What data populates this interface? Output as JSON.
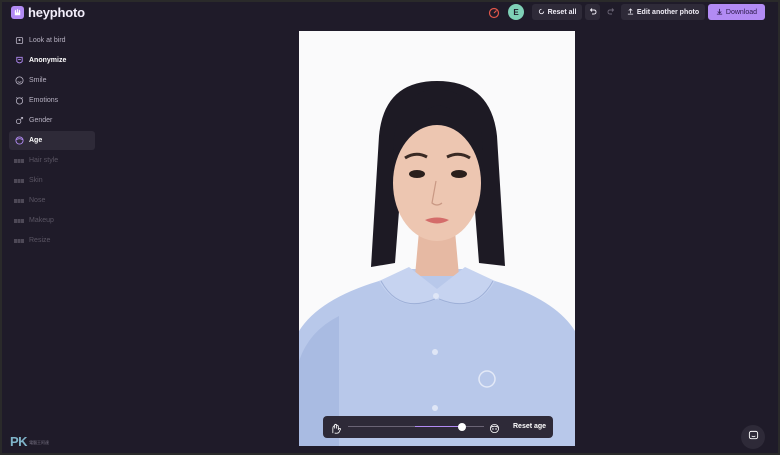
{
  "app": {
    "name": "heyphoto",
    "accent": "#b28bf4",
    "background": "#1f1b29"
  },
  "header": {
    "avatar_initial": "E",
    "reset_all": "Reset all",
    "edit_another": "Edit another photo",
    "download": "Download"
  },
  "sidebar": {
    "items": [
      {
        "label": "Look at bird",
        "icon": "bird-icon",
        "state": "normal"
      },
      {
        "label": "Anonymize",
        "icon": "mask-icon",
        "state": "strong"
      },
      {
        "label": "Smile",
        "icon": "smile-icon",
        "state": "normal"
      },
      {
        "label": "Emotions",
        "icon": "emotions-icon",
        "state": "normal"
      },
      {
        "label": "Gender",
        "icon": "gender-icon",
        "state": "normal"
      },
      {
        "label": "Age",
        "icon": "age-icon",
        "state": "active"
      },
      {
        "label": "Hair style",
        "icon": "lock-dots-icon",
        "state": "disabled"
      },
      {
        "label": "Skin",
        "icon": "lock-dots-icon",
        "state": "disabled"
      },
      {
        "label": "Nose",
        "icon": "lock-dots-icon",
        "state": "disabled"
      },
      {
        "label": "Makeup",
        "icon": "lock-dots-icon",
        "state": "disabled"
      },
      {
        "label": "Resize",
        "icon": "lock-dots-icon",
        "state": "disabled"
      }
    ]
  },
  "age_slider": {
    "min_icon": "young-face-icon",
    "max_icon": "old-face-icon",
    "value": 0.84,
    "reset_label": "Reset age"
  },
  "watermark": {
    "main": "PK",
    "sub": "電腦王阿達"
  }
}
